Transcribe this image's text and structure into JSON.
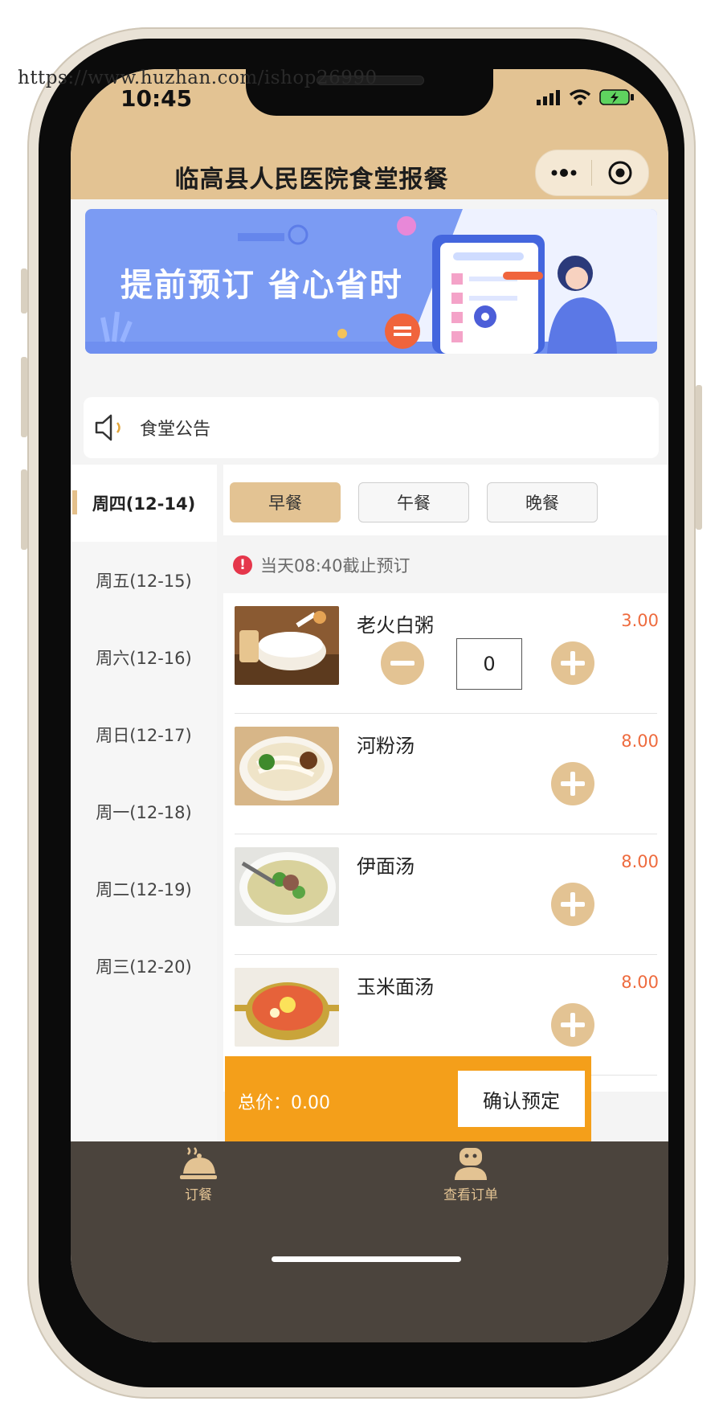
{
  "watermark": "https://www.huzhan.com/ishop26990",
  "status_bar": {
    "time": "10:45"
  },
  "header": {
    "title": "临高县人民医院食堂报餐"
  },
  "banner": {
    "text": "提前预订  省心省时"
  },
  "notice": {
    "label": "食堂公告"
  },
  "dates": [
    {
      "label": "周四(12-14)",
      "active": true
    },
    {
      "label": "周五(12-15)"
    },
    {
      "label": "周六(12-16)"
    },
    {
      "label": "周日(12-17)"
    },
    {
      "label": "周一(12-18)"
    },
    {
      "label": "周二(12-19)"
    },
    {
      "label": "周三(12-20)"
    }
  ],
  "meal_tabs": [
    {
      "label": "早餐",
      "active": true
    },
    {
      "label": "午餐"
    },
    {
      "label": "晚餐"
    }
  ],
  "deadline": {
    "text": "当天08:40截止预订"
  },
  "items": [
    {
      "name": "老火白粥",
      "price": "3.00",
      "quantity": "0"
    },
    {
      "name": "河粉汤",
      "price": "8.00"
    },
    {
      "name": "伊面汤",
      "price": "8.00"
    },
    {
      "name": "玉米面汤",
      "price": "8.00"
    }
  ],
  "footer": {
    "total": "总价：0.00",
    "confirm": "确认预定"
  },
  "tabbar": [
    {
      "label": "订餐",
      "icon": "dish-icon"
    },
    {
      "label": "查看订单",
      "icon": "user-icon"
    }
  ],
  "colors": {
    "accent": "#e3c393",
    "price": "#ee6b3e",
    "total_bar": "#f49f1a",
    "tabbar": "#4b443d"
  }
}
